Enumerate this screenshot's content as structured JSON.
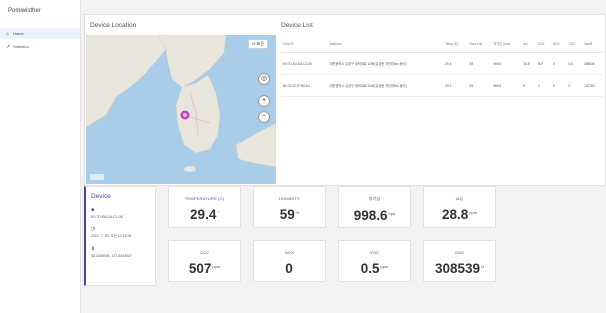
{
  "app": {
    "brand": "Pomiwisther"
  },
  "sidebar": {
    "items": [
      {
        "label": "Home",
        "icon": "home-icon"
      },
      {
        "label": "Statistics",
        "icon": "chart-icon"
      }
    ]
  },
  "map_panel": {
    "title": "Device Location",
    "lang_button": "⊡ 표준"
  },
  "device_list": {
    "title": "Device List",
    "columns": [
      "Chip ID",
      "Address",
      "Temp (C)",
      "Hum (%)",
      "대기압 (hpa)",
      "iaq",
      "CO2",
      "NOX",
      "VOC",
      "GasR"
    ],
    "rows": [
      [
        "E0:7D:EA:DA:C1:08",
        "대전광역시 유성구 대덕대로 1189(유성동 가단위5cs 동지)",
        "29.4",
        "59",
        "998.6",
        "28.8",
        "507",
        "0",
        "0.5",
        "308539"
      ],
      [
        "B0:01:02:7F:B0:A1",
        "대전광역시 유성구 대덕대로 1189(유성동 가단위5cs 동지)",
        "33.2",
        "55",
        "989.6",
        "0",
        "0",
        "0",
        "0",
        "142784"
      ]
    ]
  },
  "device_card": {
    "title": "Device",
    "chip_id": "E0:7D:EA:DA:C1:08",
    "time": "2022. 7. 30. 오전 12:18:34",
    "coords": "36.4250006, 127.4444047"
  },
  "metrics": {
    "temperature": {
      "label": "TEMPERATURE (C)",
      "value": "29.4",
      "unit": "°"
    },
    "humidity": {
      "label": "HUMIDITY",
      "value": "59",
      "unit": "%"
    },
    "pressure": {
      "label": "대기압",
      "value": "998.6",
      "unit": "hpa"
    },
    "iaq": {
      "label": "IAQ",
      "value": "28.8",
      "unit": "ppm"
    },
    "co2": {
      "label": "CO2",
      "value": "507",
      "unit": "ppm"
    },
    "nox": {
      "label": "NOX",
      "value": "0",
      "unit": ""
    },
    "voc": {
      "label": "VOC",
      "value": "0.5",
      "unit": "ppm"
    },
    "gas": {
      "label": "GAS",
      "value": "308539",
      "unit": "Ω"
    }
  },
  "colors": {
    "accent": "#5b3fa6",
    "map_water": "#a9cde8",
    "map_land": "#e9e6de"
  }
}
